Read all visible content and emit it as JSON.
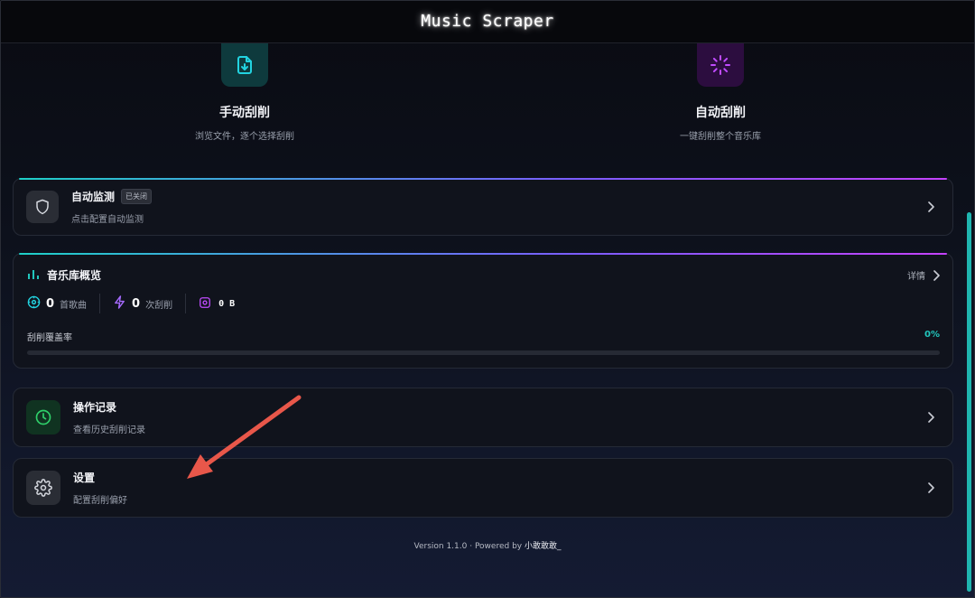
{
  "app": {
    "title": "Music Scraper"
  },
  "modes": {
    "manual": {
      "name": "手动刮削",
      "desc": "浏览文件，逐个选择刮削",
      "icon": "file-download-icon",
      "color": "#22d3e0"
    },
    "auto": {
      "name": "自动刮削",
      "desc": "一键刮削整个音乐库",
      "icon": "loader-icon",
      "color": "#c14bff"
    }
  },
  "monitor": {
    "title": "自动监测",
    "badge": "已关闭",
    "subtitle": "点击配置自动监测",
    "icon": "shield-icon"
  },
  "overview": {
    "title": "音乐库概览",
    "detail_label": "详情",
    "songs": {
      "value": "0",
      "unit": "首歌曲"
    },
    "scrapes": {
      "value": "0",
      "unit": "次刮削"
    },
    "size": {
      "value": "0 B"
    },
    "coverage_label": "刮削覆盖率",
    "coverage_pct": "0%",
    "coverage_value": 0
  },
  "history": {
    "title": "操作记录",
    "subtitle": "查看历史刮削记录",
    "icon": "clock-icon"
  },
  "settings": {
    "title": "设置",
    "subtitle": "配置刮削偏好",
    "icon": "gear-icon"
  },
  "footer": {
    "prefix": "Version 1.1.0 · Powered by ",
    "author": "小敢敢敢_"
  },
  "colors": {
    "accent_teal": "#22c6bd",
    "accent_purple": "#c14bff",
    "annotation_arrow": "#e8574a"
  }
}
